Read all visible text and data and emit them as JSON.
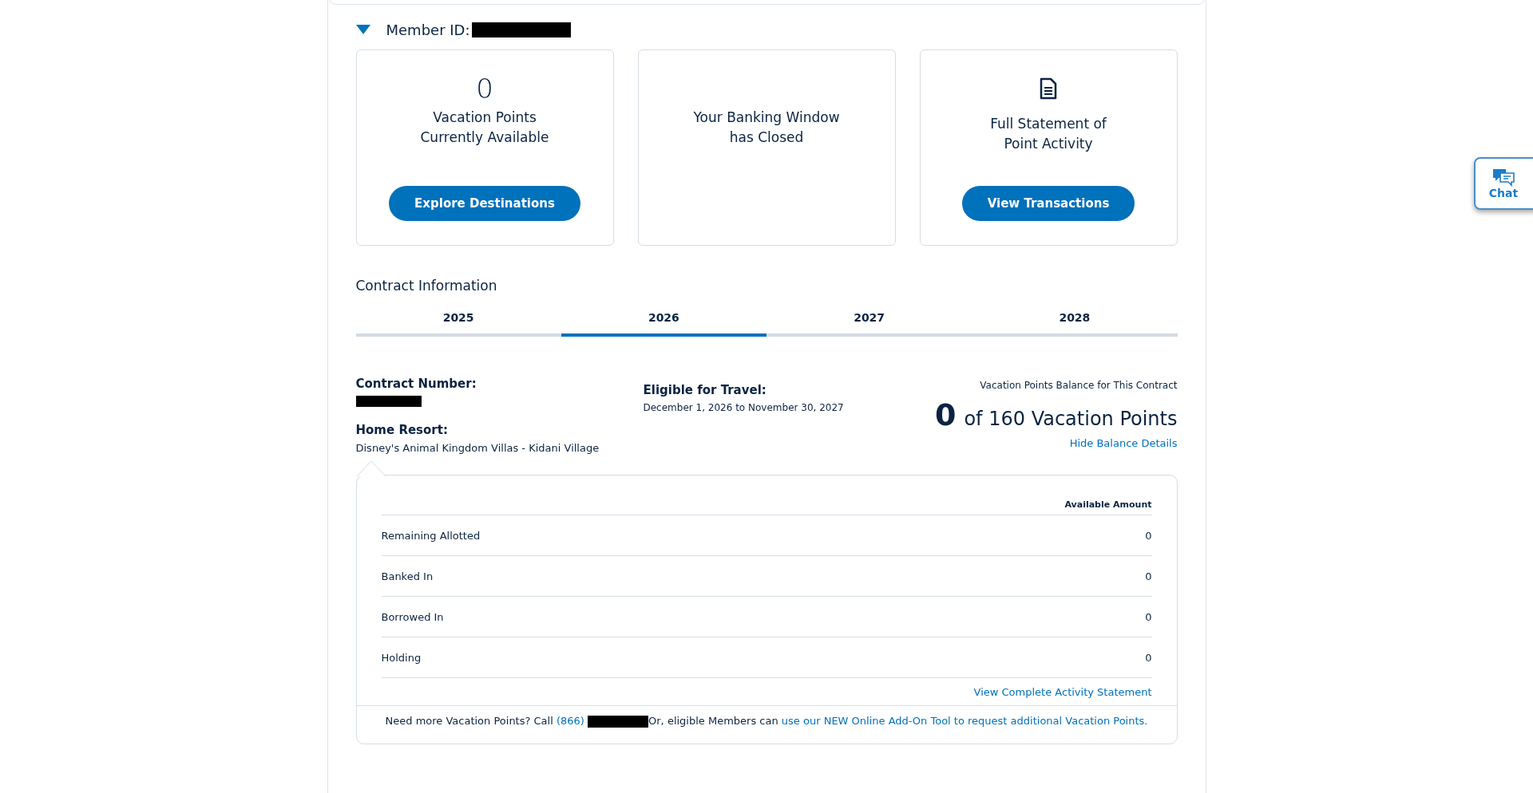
{
  "member": {
    "label": "Member ID:",
    "expanded": true
  },
  "cards": [
    {
      "kind": "points",
      "value": "0",
      "lines": [
        "Vacation Points",
        "Currently Available"
      ],
      "button": "Explore Destinations"
    },
    {
      "kind": "message",
      "lines": [
        "Your Banking Window",
        "has Closed"
      ]
    },
    {
      "kind": "statement",
      "lines": [
        "Full Statement of",
        "Point Activity"
      ],
      "button": "View Transactions"
    }
  ],
  "contract": {
    "title": "Contract Information",
    "tabs": [
      {
        "label": "2025",
        "selected": false
      },
      {
        "label": "2026",
        "selected": true
      },
      {
        "label": "2027",
        "selected": false
      },
      {
        "label": "2028",
        "selected": false
      }
    ],
    "number_label": "Contract Number:",
    "home_resort_label": "Home Resort:",
    "home_resort": "Disney's Animal Kingdom Villas - Kidani Village",
    "travel_label": "Eligible for Travel:",
    "travel_dates": "December 1, 2026 to November 30, 2027",
    "balance_label": "Vacation Points Balance for This Contract",
    "balance_value": "0",
    "balance_text": "of 160 Vacation Points",
    "toggle_link": "Hide Balance Details"
  },
  "balance_table": {
    "column": "Available Amount",
    "rows": [
      {
        "label": "Remaining Allotted",
        "amount": "0"
      },
      {
        "label": "Banked In",
        "amount": "0"
      },
      {
        "label": "Borrowed In",
        "amount": "0"
      },
      {
        "label": "Holding",
        "amount": "0"
      }
    ],
    "statement_link": "View Complete Activity Statement"
  },
  "footer": {
    "before": "Need more Vacation Points? Call",
    "phone": "(866)",
    "after": "Or, eligible Members can",
    "link": "use our NEW Online Add-On Tool to request additional Vacation Points."
  },
  "chat": {
    "label": "Chat"
  }
}
